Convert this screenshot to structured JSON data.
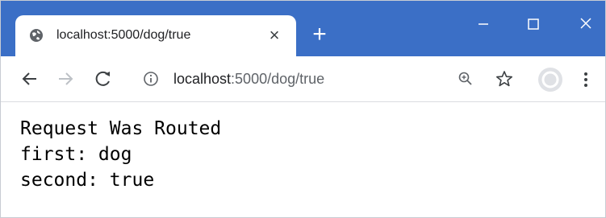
{
  "tab": {
    "title": "localhost:5000/dog/true",
    "favicon": "globe-icon",
    "close": "close-icon"
  },
  "window_controls": [
    "minimize-icon",
    "maximize-icon",
    "close-icon"
  ],
  "toolbar": {
    "url_host": "localhost",
    "url_rest": ":5000/dog/true",
    "icons": [
      "back-arrow-icon",
      "forward-arrow-icon",
      "reload-icon",
      "info-icon",
      "zoom-icon",
      "star-icon",
      "profile-avatar",
      "menu-icon"
    ]
  },
  "content": {
    "lines": [
      "Request Was Routed",
      "first: dog",
      "second: true"
    ]
  },
  "colors": {
    "titlebar": "#3b6fc6",
    "tab": "#ffffff",
    "text": "#000000"
  }
}
